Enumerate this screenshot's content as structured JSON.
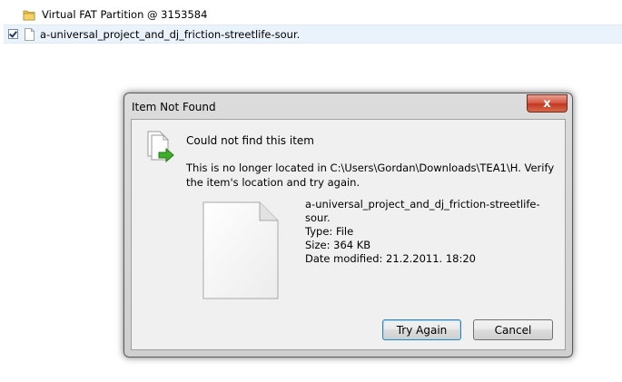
{
  "explorer": {
    "folder_label": "Virtual FAT Partition @ 3153584",
    "file_label": "a-universal_project_and_dj_friction-streetlife-sour."
  },
  "dialog": {
    "title": "Item Not Found",
    "close_glyph": "x",
    "heading": "Could not find this item",
    "message": "This is no longer located in C:\\Users\\Gordan\\Downloads\\TEA1\\H. Verify the item's location and try again.",
    "file_name": "a-universal_project_and_dj_friction-streetlife-sour.",
    "type_line": "Type: File",
    "size_line": "Size: 364 KB",
    "modified_line": "Date modified: 21.2.2011. 18:20",
    "buttons": {
      "try_again": "Try Again",
      "cancel": "Cancel"
    }
  },
  "colors": {
    "close_button": "#c2361f",
    "default_button_border": "#3c7fb1",
    "arrow": "#3fae2a"
  },
  "icons": {
    "folder": "folder-icon",
    "file_small": "document-icon",
    "file_moved": "document-arrow-icon",
    "file_large": "document-icon"
  }
}
